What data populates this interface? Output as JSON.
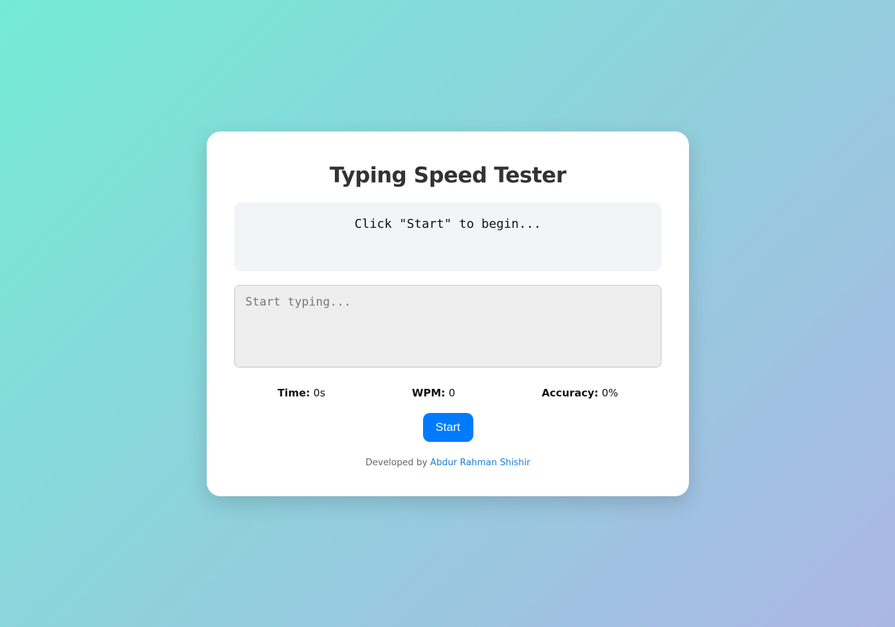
{
  "app": {
    "title": "Typing Speed Tester"
  },
  "quote": {
    "text": "Click \"Start\" to begin..."
  },
  "input": {
    "placeholder": "Start typing...",
    "value": ""
  },
  "stats": {
    "time_label": "Time:",
    "time_value": "0s",
    "wpm_label": "WPM:",
    "wpm_value": "0",
    "accuracy_label": "Accuracy:",
    "accuracy_value": "0%"
  },
  "controls": {
    "start_label": "Start"
  },
  "footer": {
    "prefix": "Developed by ",
    "author": "Abdur Rahman Shishir"
  },
  "colors": {
    "accent": "#007bff",
    "link": "#1a7fd6",
    "gradient_start": "#74ebd5",
    "gradient_end": "#acb6e5"
  }
}
